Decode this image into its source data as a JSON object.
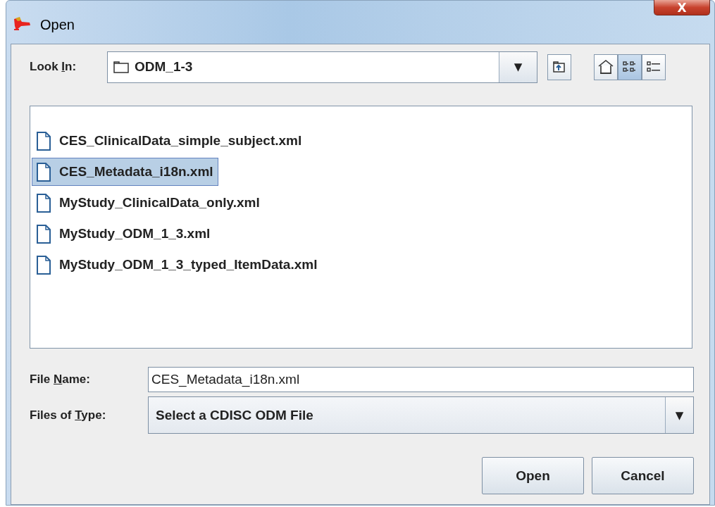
{
  "window": {
    "title": "Open",
    "close_label": "X"
  },
  "look_in": {
    "label_before": "Look ",
    "mnemonic": "I",
    "label_after": "n:",
    "value": "ODM_1-3",
    "arrow": "▼"
  },
  "toolbar": [
    {
      "kind": "up",
      "selected": false
    },
    {
      "kind": "home",
      "selected": false
    },
    {
      "kind": "list",
      "selected": true
    },
    {
      "kind": "details",
      "selected": false
    }
  ],
  "files": [
    {
      "name": "CES_ClinicalData_simple_subject.xml",
      "selected": false
    },
    {
      "name": "CES_Metadata_i18n.xml",
      "selected": true
    },
    {
      "name": "MyStudy_ClinicalData_only.xml",
      "selected": false
    },
    {
      "name": "MyStudy_ODM_1_3.xml",
      "selected": false
    },
    {
      "name": "MyStudy_ODM_1_3_typed_ItemData.xml",
      "selected": false
    }
  ],
  "file_name": {
    "label_before": "File ",
    "mnemonic": "N",
    "label_after": "ame:",
    "value": "CES_Metadata_i18n.xml"
  },
  "file_type": {
    "label_before": "Files of ",
    "mnemonic": "T",
    "label_after": "ype:",
    "value": "Select a CDISC ODM File",
    "arrow": "▼"
  },
  "buttons": [
    "Open",
    "Cancel"
  ]
}
